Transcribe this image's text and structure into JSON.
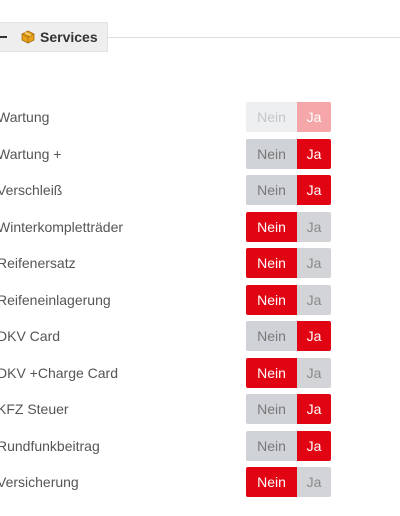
{
  "section": {
    "title": "Services",
    "icon": "package-icon"
  },
  "toggle_labels": {
    "off": "Nein",
    "on": "Ja"
  },
  "colors": {
    "accent_red": "#e10514",
    "inactive_gray": "#cfd2d6",
    "disabled_red": "#f4a6a8"
  },
  "services": [
    {
      "label": "Wartung",
      "selected": "Ja",
      "disabled": true
    },
    {
      "label": "Wartung +",
      "selected": "Ja",
      "disabled": false
    },
    {
      "label": "Verschleiß",
      "selected": "Ja",
      "disabled": false
    },
    {
      "label": "Winterkompletträder",
      "selected": "Nein",
      "disabled": false
    },
    {
      "label": "Reifenersatz",
      "selected": "Nein",
      "disabled": false
    },
    {
      "label": "Reifeneinlagerung",
      "selected": "Nein",
      "disabled": false
    },
    {
      "label": "DKV Card",
      "selected": "Ja",
      "disabled": false
    },
    {
      "label": "DKV +Charge Card",
      "selected": "Nein",
      "disabled": false
    },
    {
      "label": "KFZ Steuer",
      "selected": "Ja",
      "disabled": false
    },
    {
      "label": "Rundfunkbeitrag",
      "selected": "Ja",
      "disabled": false
    },
    {
      "label": "Versicherung",
      "selected": "Nein",
      "disabled": false
    }
  ]
}
